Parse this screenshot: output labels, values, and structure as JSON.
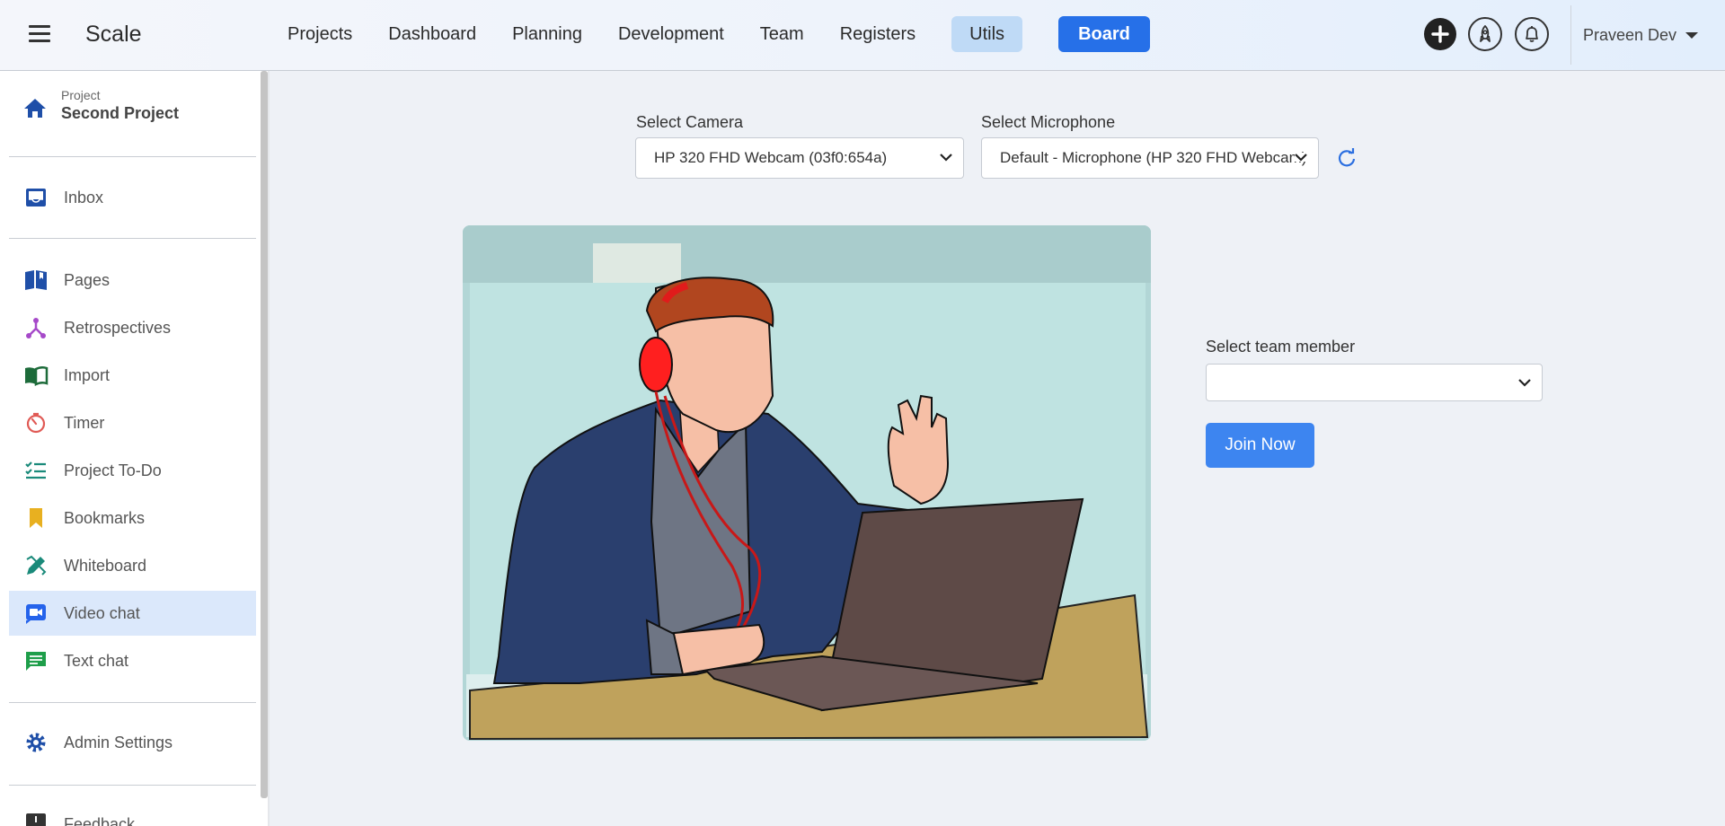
{
  "header": {
    "brand": "Scale",
    "nav": [
      "Projects",
      "Dashboard",
      "Planning",
      "Development",
      "Team",
      "Registers",
      "Utils",
      "Board"
    ],
    "user": "Praveen Dev"
  },
  "sidebar": {
    "project_caption": "Project",
    "project_name": "Second Project",
    "items": [
      {
        "label": "Inbox",
        "icon": "inbox-icon"
      },
      {
        "label": "Pages",
        "icon": "book-icon"
      },
      {
        "label": "Retrospectives",
        "icon": "network-icon"
      },
      {
        "label": "Import",
        "icon": "open-book-icon"
      },
      {
        "label": "Timer",
        "icon": "timer-icon"
      },
      {
        "label": "Project To-Do",
        "icon": "checklist-icon"
      },
      {
        "label": "Bookmarks",
        "icon": "bookmark-icon"
      },
      {
        "label": "Whiteboard",
        "icon": "pencil-ruler-icon"
      },
      {
        "label": "Video chat",
        "icon": "video-icon"
      },
      {
        "label": "Text chat",
        "icon": "chat-icon"
      },
      {
        "label": "Admin Settings",
        "icon": "gear-icon"
      },
      {
        "label": "Feedback",
        "icon": "feedback-icon"
      }
    ]
  },
  "main": {
    "camera_label": "Select Camera",
    "camera_value": "HP 320 FHD Webcam (03f0:654a)",
    "mic_label": "Select Microphone",
    "mic_value": "Default - Microphone (HP 320 FHD Webcam)",
    "team_label": "Select team member",
    "team_value": "",
    "join_label": "Join Now"
  },
  "colors": {
    "accent": "#2670e8",
    "active_item": "#dbe8fb",
    "join_button": "#3d85f0"
  }
}
